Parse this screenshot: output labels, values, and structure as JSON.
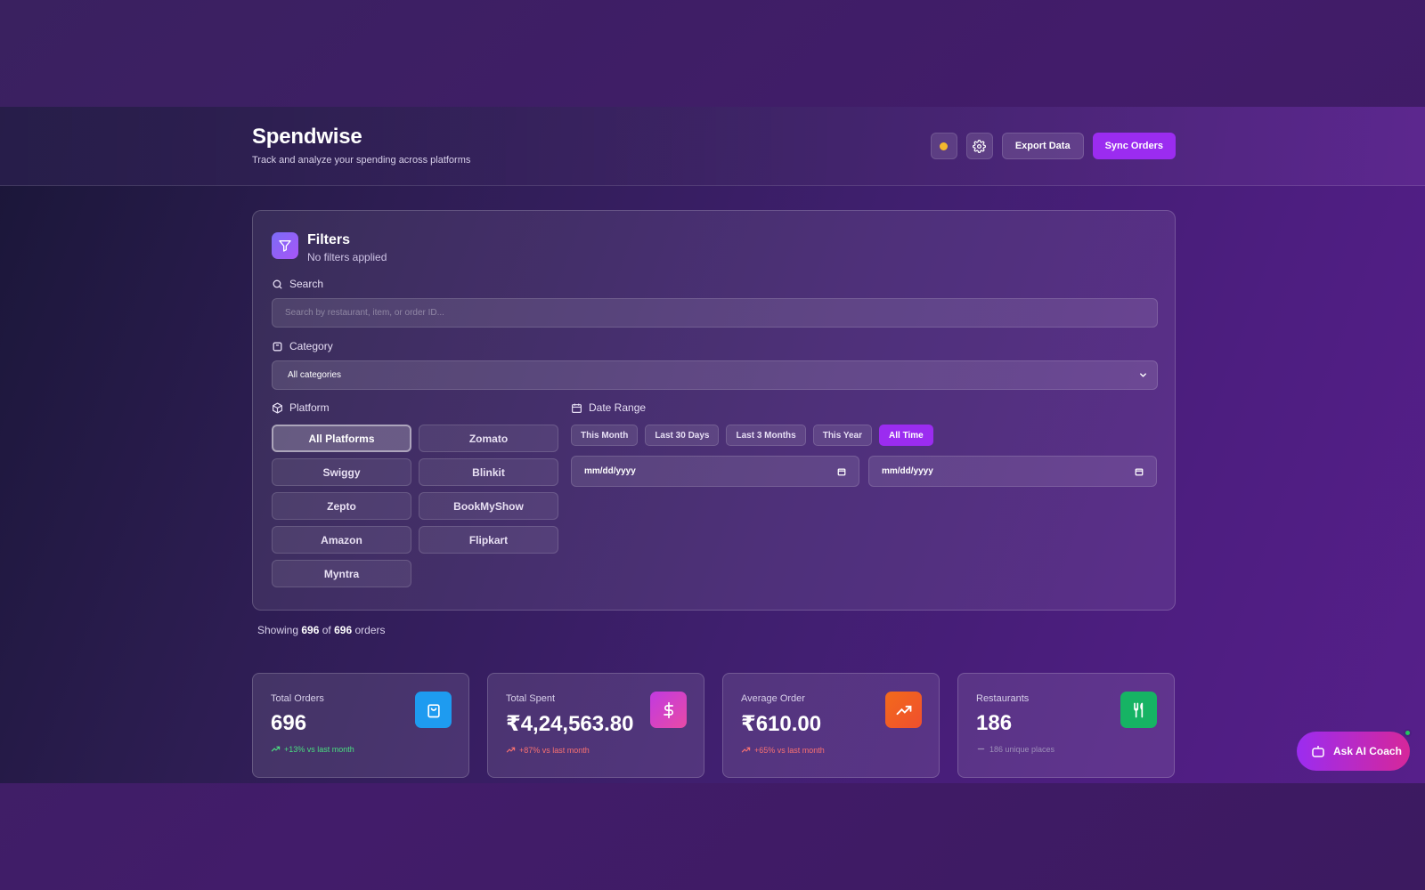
{
  "header": {
    "title": "Spendwise",
    "subtitle": "Track and analyze your spending across platforms",
    "export_label": "Export Data",
    "sync_label": "Sync Orders"
  },
  "filters": {
    "title": "Filters",
    "status": "No filters applied",
    "search_label": "Search",
    "search_placeholder": "Search by restaurant, item, or order ID...",
    "category_label": "Category",
    "category_selected": "All categories",
    "platform_label": "Platform",
    "platforms": [
      "All Platforms",
      "Zomato",
      "Swiggy",
      "Blinkit",
      "Zepto",
      "BookMyShow",
      "Amazon",
      "Flipkart",
      "Myntra"
    ],
    "active_platform": "All Platforms",
    "date_label": "Date Range",
    "date_presets": [
      "This Month",
      "Last 30 Days",
      "Last 3 Months",
      "This Year",
      "All Time"
    ],
    "active_preset": "All Time",
    "start_date_placeholder": "mm/dd/yyyy",
    "end_date_placeholder": "mm/dd/yyyy"
  },
  "showing": {
    "prefix": "Showing",
    "shown": "696",
    "of": "of",
    "total": "696",
    "suffix": "orders"
  },
  "stats": [
    {
      "title": "Total Orders",
      "value": "696",
      "trend": "+13% vs last month",
      "trend_type": "up-green",
      "icon": "shopping-bag-icon",
      "icon_color": "#1e9bf0"
    },
    {
      "title": "Total Spent",
      "value": "₹4,24,563.80",
      "trend": "+87% vs last month",
      "trend_type": "up-red",
      "icon": "dollar-icon",
      "icon_color": "#c13ae0"
    },
    {
      "title": "Average Order",
      "value": "₹610.00",
      "trend": "+65% vs last month",
      "trend_type": "up-red",
      "icon": "trending-up-icon",
      "icon_color": "#f26a1b"
    },
    {
      "title": "Restaurants",
      "value": "186",
      "trend": "186 unique places",
      "trend_type": "neutral",
      "icon": "utensils-icon",
      "icon_color": "#16b364"
    }
  ],
  "coach": {
    "label": "Ask AI Coach"
  },
  "colors": {
    "accent": "#9b2cf0",
    "indicator": "#f5b82e"
  }
}
